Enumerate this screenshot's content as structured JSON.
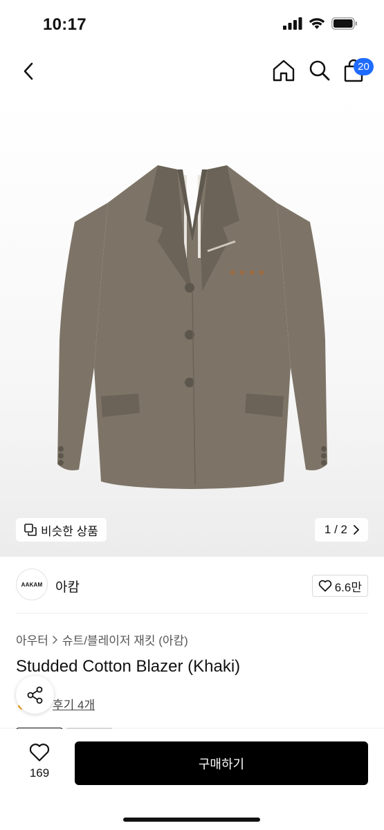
{
  "status_bar": {
    "time": "10:17"
  },
  "nav": {
    "cart_count": "20"
  },
  "hero": {
    "similar_label": "비슷한 상품",
    "page_indicator": "1 / 2",
    "colors": {
      "jacket": "#7d7467",
      "jacket_shadow": "#6b6357",
      "button": "#5d564c"
    }
  },
  "brand": {
    "logo_text": "AAKAM",
    "name": "아캄",
    "likes": "6.6만"
  },
  "breadcrumb": {
    "category": "아우터",
    "subcategory": "슈트/블레이저 재킷 (아캄)"
  },
  "product": {
    "title": "Studded Cotton Blazer (Khaki)",
    "review_text": "후기 4개"
  },
  "bottom": {
    "wish_count": "169",
    "buy_label": "구매하기"
  }
}
